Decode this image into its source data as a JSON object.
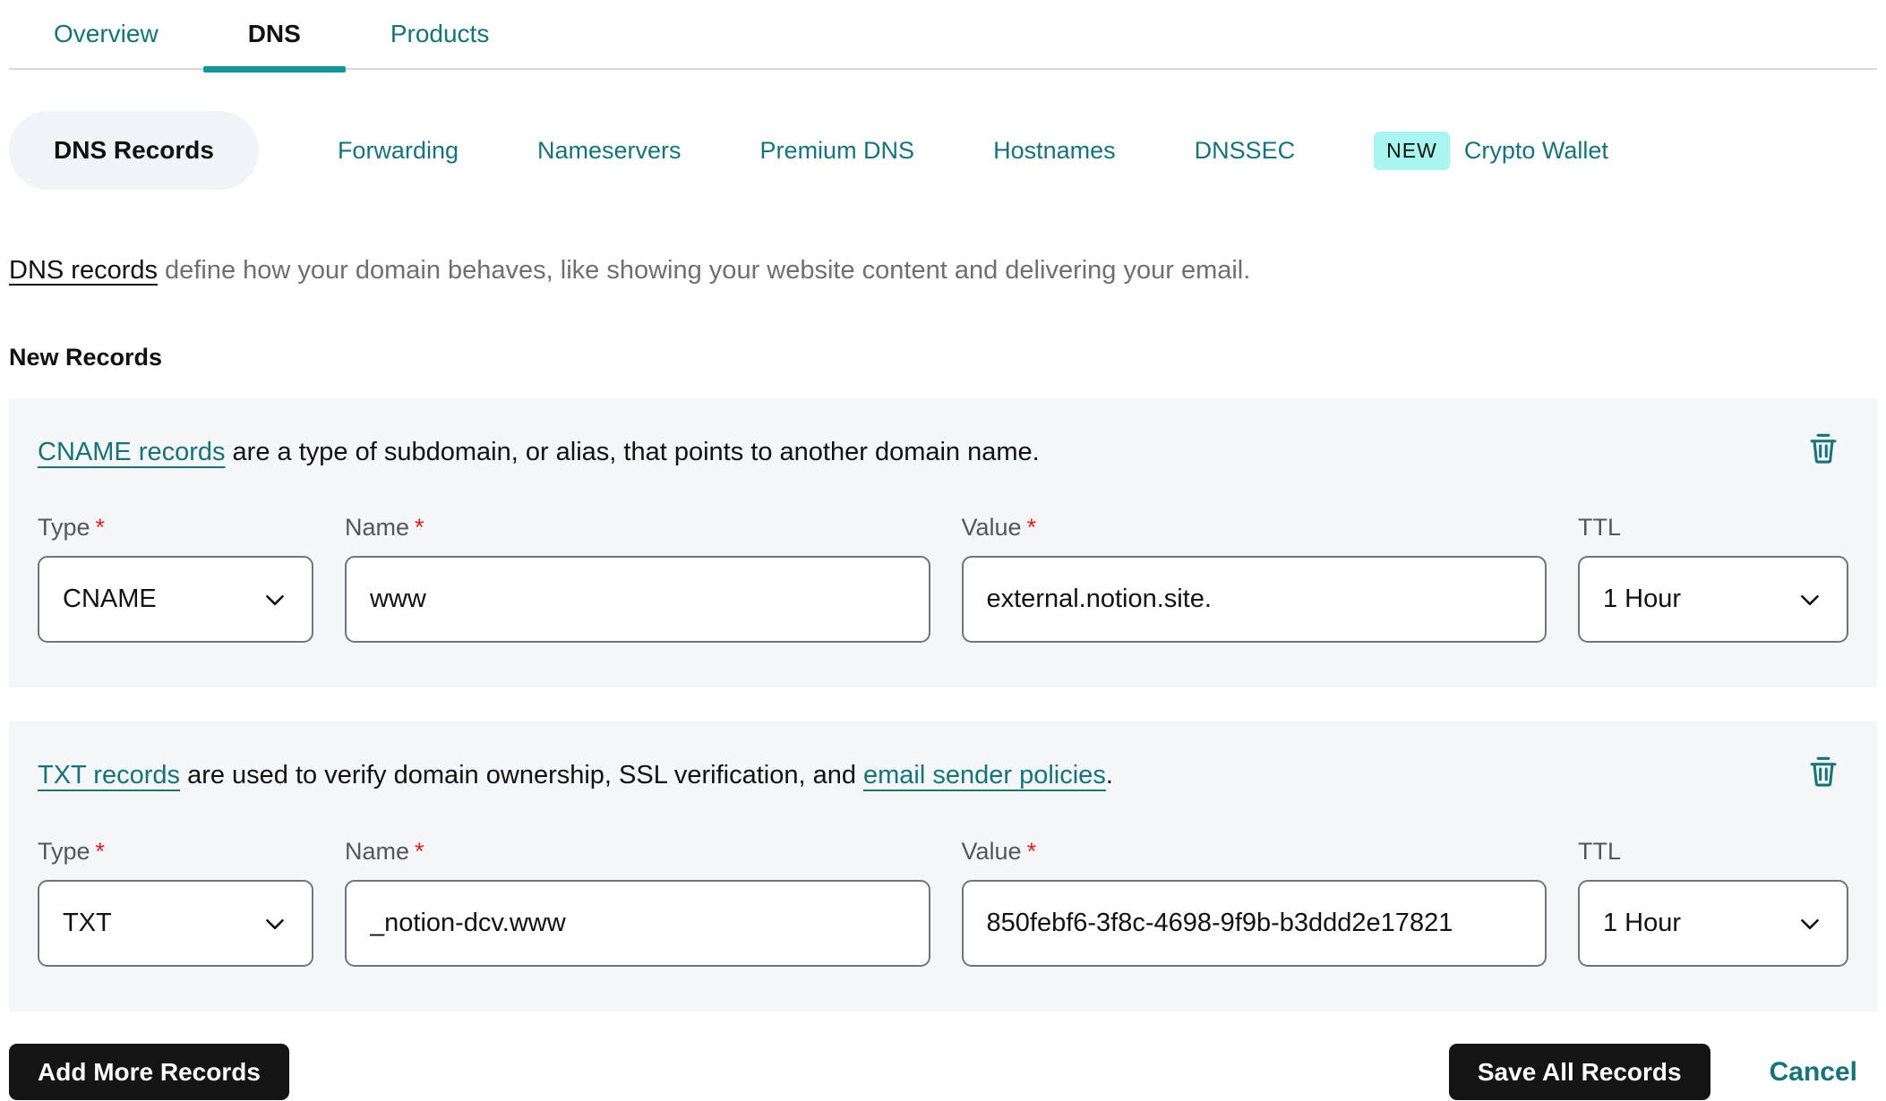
{
  "colors": {
    "teal_link": "#16727b",
    "active_tab_underline": "#12949a",
    "new_badge_bg": "#a9f6f0",
    "card_bg": "#f5f6f8",
    "input_border": "#717478",
    "label_gray": "#55565a",
    "description_gray": "#6f6f6f",
    "required_red": "#d8251c",
    "button_black": "#141414"
  },
  "tabs": [
    {
      "label": "Overview",
      "active": false
    },
    {
      "label": "DNS",
      "active": true
    },
    {
      "label": "Products",
      "active": false
    }
  ],
  "subnav": {
    "active_item": "DNS Records",
    "items": [
      "Forwarding",
      "Nameservers",
      "Premium DNS",
      "Hostnames",
      "DNSSEC"
    ],
    "new_badge": "NEW",
    "badged_item": "Crypto Wallet"
  },
  "intro": {
    "link_text": "DNS records",
    "text": " define how your domain behaves, like showing your website content and delivering your email."
  },
  "section_title": "New Records",
  "ui": {
    "required_marker": "*"
  },
  "records": [
    {
      "desc_link": "CNAME records",
      "desc_mid": " are a type of subdomain, or alias, that points to another domain name.",
      "desc_link2": "",
      "desc_end": "",
      "type_label": "Type",
      "type_value": "CNAME",
      "name_label": "Name",
      "name_value": "www",
      "value_label": "Value",
      "value_value": "external.notion.site.",
      "ttl_label": "TTL",
      "ttl_value": "1 Hour"
    },
    {
      "desc_link": "TXT records",
      "desc_mid": " are used to verify domain ownership, SSL verification, and ",
      "desc_link2": "email sender policies",
      "desc_end": ".",
      "type_label": "Type",
      "type_value": "TXT",
      "name_label": "Name",
      "name_value": "_notion-dcv.www",
      "value_label": "Value",
      "value_value": "850febf6-3f8c-4698-9f9b-b3ddd2e17821",
      "ttl_label": "TTL",
      "ttl_value": "1 Hour"
    }
  ],
  "actions": {
    "add_more": "Add More Records",
    "save_all": "Save All Records",
    "cancel": "Cancel"
  }
}
